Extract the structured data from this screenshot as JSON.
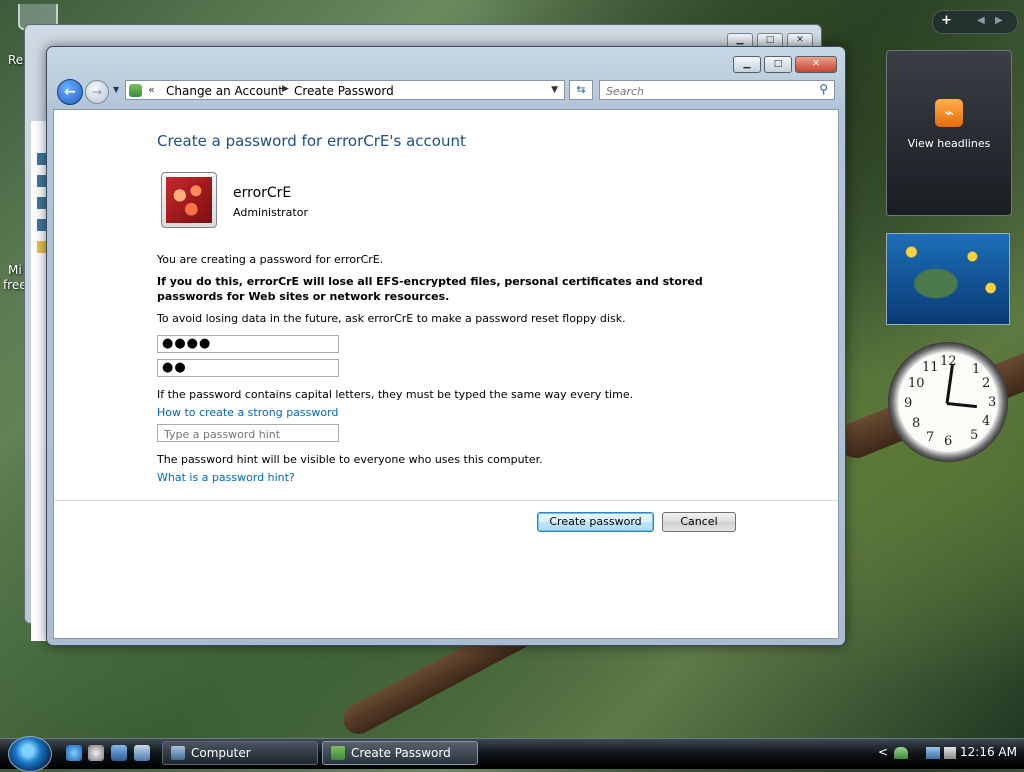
{
  "desktop": {
    "label_1": "Re",
    "label_2": "Mi",
    "label_3": "free"
  },
  "window": {
    "nav": {
      "breadcrumb_chevron": "«",
      "crumb_1": "Change an Account",
      "crumb_2": "Create Password"
    },
    "search_placeholder": "Search",
    "content": {
      "title": "Create a password for errorCrE's account",
      "user_name": "errorCrE",
      "user_role": "Administrator",
      "intro_text": "You are creating a password for errorCrE.",
      "warning_text": "If you do this, errorCrE will lose all EFS-encrypted files, personal certificates and stored passwords for Web sites or network resources.",
      "reset_text": "To avoid losing data in the future, ask errorCrE to make a password reset floppy disk.",
      "new_password_value": "●●●●",
      "confirm_password_value": "●●",
      "capital_text": "If the password contains capital letters, they must be typed the same way every time.",
      "strong_password_link": "How to create a strong password",
      "hint_placeholder": "Type a password hint",
      "hint_visible_text": "The password hint will be visible to everyone who uses this computer.",
      "hint_link": "What is a password hint?",
      "create_button": "Create password",
      "cancel_button": "Cancel"
    }
  },
  "sidebar": {
    "add_symbol": "+",
    "rss_label": "View headlines",
    "clock": {
      "hour": 12,
      "minute": 16
    }
  },
  "taskbar": {
    "tasks": [
      {
        "label": "Computer"
      },
      {
        "label": "Create Password"
      }
    ],
    "tray_arrow": "<",
    "time": "12:16 AM"
  }
}
